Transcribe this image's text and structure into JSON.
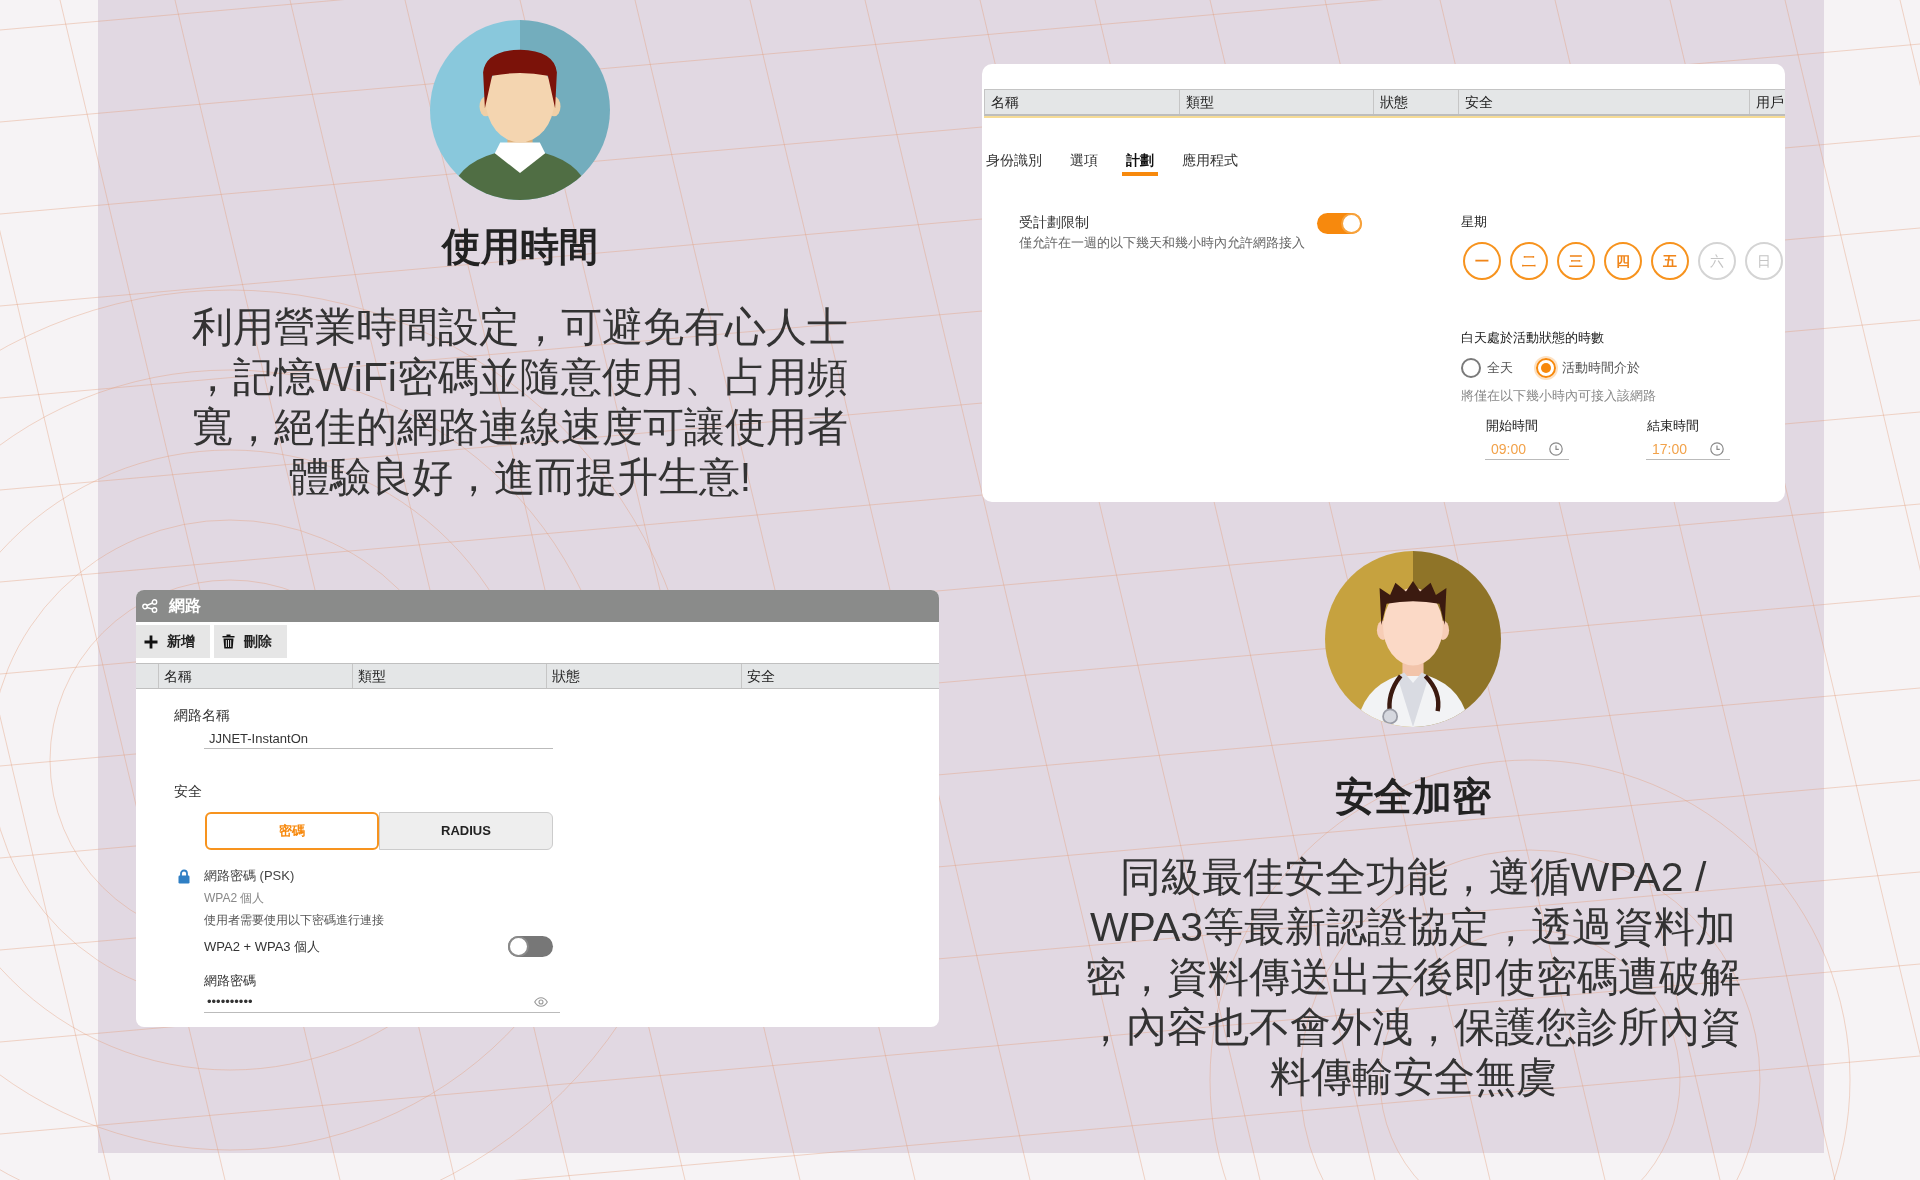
{
  "usage_time": {
    "title": "使用時間",
    "description": "利用營業時間設定，可避免有心人士，記憶WiFi密碼並隨意使用、占用頻寬，絕佳的網路連線速度可讓使用者體驗良好，進而提升生意!"
  },
  "schedule_panel": {
    "columns": [
      "名稱",
      "類型",
      "狀態",
      "安全",
      "用戶"
    ],
    "tabs": [
      {
        "label": "身份識別",
        "selected": false
      },
      {
        "label": "選項",
        "selected": false
      },
      {
        "label": "計劃",
        "selected": true
      },
      {
        "label": "應用程式",
        "selected": false
      }
    ],
    "schedule_limit": {
      "label": "受計劃限制",
      "description": "僅允許在一週的以下幾天和幾小時內允許網路接入",
      "on": true
    },
    "weekdays": {
      "label": "星期",
      "days": [
        {
          "label": "一",
          "selected": true
        },
        {
          "label": "二",
          "selected": true
        },
        {
          "label": "三",
          "selected": true
        },
        {
          "label": "四",
          "selected": true
        },
        {
          "label": "五",
          "selected": true
        },
        {
          "label": "六",
          "selected": false
        },
        {
          "label": "日",
          "selected": false
        }
      ]
    },
    "active_hours": {
      "label": "白天處於活動狀態的時數",
      "options": [
        {
          "label": "全天",
          "selected": false
        },
        {
          "label": "活動時間介於",
          "selected": true
        }
      ],
      "note": "將僅在以下幾小時內可接入該網路",
      "start": {
        "label": "開始時間",
        "value": "09:00"
      },
      "end": {
        "label": "結束時間",
        "value": "17:00"
      }
    }
  },
  "network_panel": {
    "title": "網路",
    "toolbar": [
      {
        "kind": "add",
        "label": "新增"
      },
      {
        "kind": "delete",
        "label": "刪除"
      }
    ],
    "columns": [
      "名稱",
      "類型",
      "狀態",
      "安全"
    ],
    "network_name": {
      "label": "網路名稱",
      "value": "JJNET-InstantOn"
    },
    "security": {
      "label": "安全",
      "options": [
        {
          "label": "密碼",
          "selected": true
        },
        {
          "label": "RADIUS",
          "selected": false
        }
      ]
    },
    "psk": {
      "title": "網路密碼 (PSK)",
      "mode": "WPA2 個人",
      "hint": "使用者需要使用以下密碼進行連接"
    },
    "wpa3": {
      "label": "WPA2 + WPA3 個人",
      "on": false
    },
    "password": {
      "label": "網路密碼",
      "value": "••••••••••"
    }
  },
  "security_encryption": {
    "title": "安全加密",
    "description": "同級最佳安全功能，遵循WPA2 / WPA3等最新認證協定，透過資料加密，資料傳送出去後即使密碼遭破解，內容也不會外洩，保護您診所內資料傳輸安全無虞"
  }
}
